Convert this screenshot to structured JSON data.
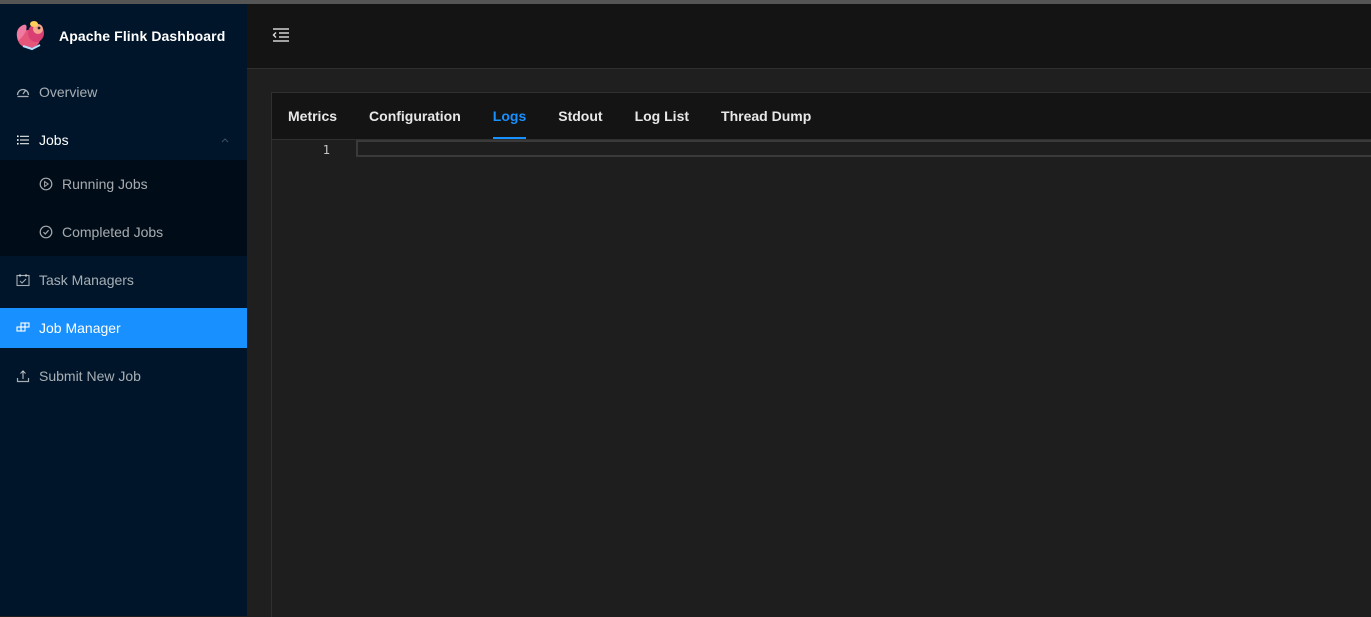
{
  "app": {
    "title": "Apache Flink Dashboard",
    "logo_icon": "flink-squirrel-logo"
  },
  "sidebar": {
    "items": [
      {
        "label": "Overview",
        "icon": "dashboard-icon"
      },
      {
        "label": "Jobs",
        "icon": "unordered-list-icon",
        "expanded": true,
        "children": [
          {
            "label": "Running Jobs",
            "icon": "play-circle-icon"
          },
          {
            "label": "Completed Jobs",
            "icon": "check-circle-icon"
          }
        ]
      },
      {
        "label": "Task Managers",
        "icon": "schedule-icon"
      },
      {
        "label": "Job Manager",
        "icon": "build-icon",
        "active": true
      },
      {
        "label": "Submit New Job",
        "icon": "upload-icon"
      }
    ]
  },
  "header": {
    "menu_fold_icon": "menu-fold-icon"
  },
  "tabs": [
    {
      "label": "Metrics"
    },
    {
      "label": "Configuration"
    },
    {
      "label": "Logs",
      "active": true
    },
    {
      "label": "Stdout"
    },
    {
      "label": "Log List"
    },
    {
      "label": "Thread Dump"
    }
  ],
  "editor": {
    "line_numbers": [
      "1"
    ],
    "content": ""
  },
  "colors": {
    "sidebar_bg": "#001529",
    "accent": "#1890ff",
    "header_bg": "#141414",
    "content_bg": "#1e1e1e"
  }
}
